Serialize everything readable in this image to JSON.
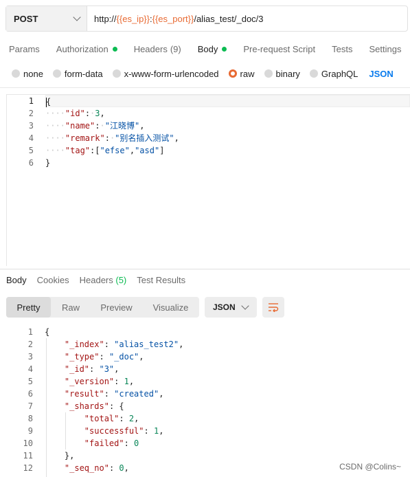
{
  "request": {
    "method": "POST",
    "url": [
      {
        "text": "http://",
        "var": false
      },
      {
        "text": "{{es_ip}}",
        "var": true
      },
      {
        "text": ":",
        "var": false
      },
      {
        "text": "{{es_port}}",
        "var": true
      },
      {
        "text": "/alias_test/_doc/3",
        "var": false
      }
    ]
  },
  "request_tabs": {
    "params": "Params",
    "authorization": "Authorization",
    "headers": "Headers",
    "headers_count": "(9)",
    "body": "Body",
    "prerequest": "Pre-request Script",
    "tests": "Tests",
    "settings": "Settings"
  },
  "body_types": {
    "none": "none",
    "form_data": "form-data",
    "urlencoded": "x-www-form-urlencoded",
    "raw": "raw",
    "binary": "binary",
    "graphql": "GraphQL",
    "language": "JSON"
  },
  "request_body": {
    "line_numbers": [
      "1",
      "2",
      "3",
      "4",
      "5",
      "6"
    ],
    "lines": [
      [
        {
          "t": "{",
          "c": "p"
        }
      ],
      [
        {
          "t": "····",
          "c": "ws"
        },
        {
          "t": "\"id\"",
          "c": "k"
        },
        {
          "t": ":",
          "c": "p"
        },
        {
          "t": "·",
          "c": "ws"
        },
        {
          "t": "3",
          "c": "n"
        },
        {
          "t": ",",
          "c": "p"
        }
      ],
      [
        {
          "t": "····",
          "c": "ws"
        },
        {
          "t": "\"name\"",
          "c": "k"
        },
        {
          "t": ":",
          "c": "p"
        },
        {
          "t": "·",
          "c": "ws"
        },
        {
          "t": "\"江晓博\"",
          "c": "s"
        },
        {
          "t": ",",
          "c": "p"
        }
      ],
      [
        {
          "t": "····",
          "c": "ws"
        },
        {
          "t": "\"remark\"",
          "c": "k"
        },
        {
          "t": ":",
          "c": "p"
        },
        {
          "t": "·",
          "c": "ws"
        },
        {
          "t": "\"别名插入测试\"",
          "c": "s"
        },
        {
          "t": ",",
          "c": "p"
        }
      ],
      [
        {
          "t": "····",
          "c": "ws"
        },
        {
          "t": "\"tag\"",
          "c": "k"
        },
        {
          "t": ":[",
          "c": "p"
        },
        {
          "t": "\"efse\"",
          "c": "s"
        },
        {
          "t": ",",
          "c": "p"
        },
        {
          "t": "\"asd\"",
          "c": "s"
        },
        {
          "t": "]",
          "c": "p"
        }
      ],
      [
        {
          "t": "}",
          "c": "p"
        }
      ]
    ]
  },
  "response_tabs": {
    "body": "Body",
    "cookies": "Cookies",
    "headers": "Headers",
    "headers_count": "(5)",
    "test_results": "Test Results"
  },
  "view_modes": {
    "pretty": "Pretty",
    "raw": "Raw",
    "preview": "Preview",
    "visualize": "Visualize",
    "format": "JSON"
  },
  "response_body": {
    "line_numbers": [
      "1",
      "2",
      "3",
      "4",
      "5",
      "6",
      "7",
      "8",
      "9",
      "10",
      "11",
      "12"
    ],
    "lines": [
      [
        {
          "t": "{",
          "c": "p"
        }
      ],
      [
        {
          "t": "    ",
          "c": "p"
        },
        {
          "t": "\"_index\"",
          "c": "k"
        },
        {
          "t": ": ",
          "c": "p"
        },
        {
          "t": "\"alias_test2\"",
          "c": "s"
        },
        {
          "t": ",",
          "c": "p"
        }
      ],
      [
        {
          "t": "    ",
          "c": "p"
        },
        {
          "t": "\"_type\"",
          "c": "k"
        },
        {
          "t": ": ",
          "c": "p"
        },
        {
          "t": "\"_doc\"",
          "c": "s"
        },
        {
          "t": ",",
          "c": "p"
        }
      ],
      [
        {
          "t": "    ",
          "c": "p"
        },
        {
          "t": "\"_id\"",
          "c": "k"
        },
        {
          "t": ": ",
          "c": "p"
        },
        {
          "t": "\"3\"",
          "c": "s"
        },
        {
          "t": ",",
          "c": "p"
        }
      ],
      [
        {
          "t": "    ",
          "c": "p"
        },
        {
          "t": "\"_version\"",
          "c": "k"
        },
        {
          "t": ": ",
          "c": "p"
        },
        {
          "t": "1",
          "c": "n"
        },
        {
          "t": ",",
          "c": "p"
        }
      ],
      [
        {
          "t": "    ",
          "c": "p"
        },
        {
          "t": "\"result\"",
          "c": "k"
        },
        {
          "t": ": ",
          "c": "p"
        },
        {
          "t": "\"created\"",
          "c": "s"
        },
        {
          "t": ",",
          "c": "p"
        }
      ],
      [
        {
          "t": "    ",
          "c": "p"
        },
        {
          "t": "\"_shards\"",
          "c": "k"
        },
        {
          "t": ": {",
          "c": "p"
        }
      ],
      [
        {
          "t": "        ",
          "c": "p"
        },
        {
          "t": "\"total\"",
          "c": "k"
        },
        {
          "t": ": ",
          "c": "p"
        },
        {
          "t": "2",
          "c": "n"
        },
        {
          "t": ",",
          "c": "p"
        }
      ],
      [
        {
          "t": "        ",
          "c": "p"
        },
        {
          "t": "\"successful\"",
          "c": "k"
        },
        {
          "t": ": ",
          "c": "p"
        },
        {
          "t": "1",
          "c": "n"
        },
        {
          "t": ",",
          "c": "p"
        }
      ],
      [
        {
          "t": "        ",
          "c": "p"
        },
        {
          "t": "\"failed\"",
          "c": "k"
        },
        {
          "t": ": ",
          "c": "p"
        },
        {
          "t": "0",
          "c": "n"
        }
      ],
      [
        {
          "t": "    },",
          "c": "p"
        }
      ],
      [
        {
          "t": "    ",
          "c": "p"
        },
        {
          "t": "\"_seq_no\"",
          "c": "k"
        },
        {
          "t": ": ",
          "c": "p"
        },
        {
          "t": "0",
          "c": "n"
        },
        {
          "t": ",",
          "c": "p"
        }
      ]
    ]
  },
  "watermark": "CSDN @Colins~",
  "colors": {
    "accent": "#e86a33",
    "status_dot": "#0cbb52",
    "language_link": "#097bed"
  }
}
